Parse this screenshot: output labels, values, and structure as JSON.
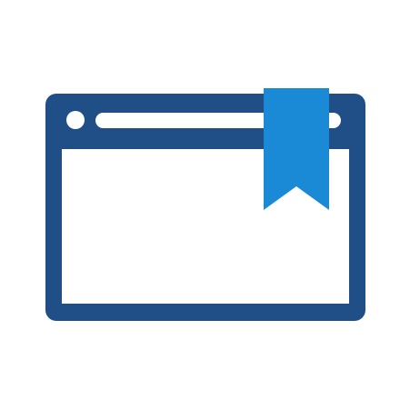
{
  "icon": {
    "name": "bookmarked-browser-window-icon",
    "colors": {
      "frame": "#1f4f86",
      "bookmark": "#1b8ad6",
      "content": "#ffffff",
      "background": "#ffffff"
    },
    "parts": [
      "window-frame",
      "window-control-dot",
      "address-bar",
      "content-area",
      "bookmark-ribbon"
    ]
  }
}
